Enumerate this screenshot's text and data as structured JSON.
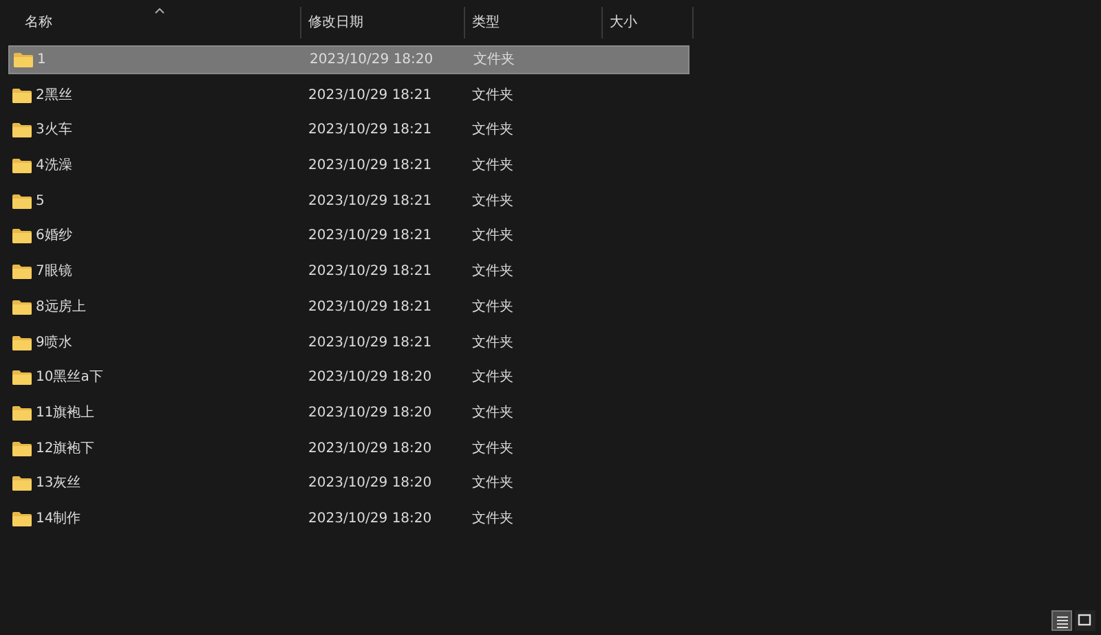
{
  "columns": [
    {
      "label": "名称",
      "sorted": true
    },
    {
      "label": "修改日期",
      "sorted": false
    },
    {
      "label": "类型",
      "sorted": false
    },
    {
      "label": "大小",
      "sorted": false
    }
  ],
  "rows": [
    {
      "name": "1",
      "modified": "2023/10/29 18:20",
      "type": "文件夹",
      "selected": true
    },
    {
      "name": "2黑丝",
      "modified": "2023/10/29 18:21",
      "type": "文件夹",
      "selected": false
    },
    {
      "name": "3火车",
      "modified": "2023/10/29 18:21",
      "type": "文件夹",
      "selected": false
    },
    {
      "name": "4洗澡",
      "modified": "2023/10/29 18:21",
      "type": "文件夹",
      "selected": false
    },
    {
      "name": "5",
      "modified": "2023/10/29 18:21",
      "type": "文件夹",
      "selected": false
    },
    {
      "name": "6婚纱",
      "modified": "2023/10/29 18:21",
      "type": "文件夹",
      "selected": false
    },
    {
      "name": "7眼镜",
      "modified": "2023/10/29 18:21",
      "type": "文件夹",
      "selected": false
    },
    {
      "name": "8远房上",
      "modified": "2023/10/29 18:21",
      "type": "文件夹",
      "selected": false
    },
    {
      "name": "9喷水",
      "modified": "2023/10/29 18:21",
      "type": "文件夹",
      "selected": false
    },
    {
      "name": "10黑丝a下",
      "modified": "2023/10/29 18:20",
      "type": "文件夹",
      "selected": false
    },
    {
      "name": "11旗袍上",
      "modified": "2023/10/29 18:20",
      "type": "文件夹",
      "selected": false
    },
    {
      "name": "12旗袍下",
      "modified": "2023/10/29 18:20",
      "type": "文件夹",
      "selected": false
    },
    {
      "name": "13灰丝",
      "modified": "2023/10/29 18:20",
      "type": "文件夹",
      "selected": false
    },
    {
      "name": "14制作",
      "modified": "2023/10/29 18:20",
      "type": "文件夹",
      "selected": false
    }
  ],
  "view_buttons": [
    {
      "kind": "details",
      "selected": true
    },
    {
      "kind": "tiles",
      "selected": false
    }
  ]
}
